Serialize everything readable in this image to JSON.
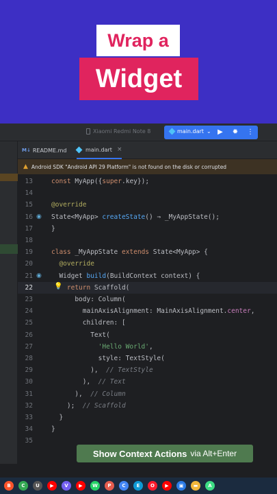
{
  "promo": {
    "line1": "Wrap a",
    "line2": "Widget"
  },
  "toolbar": {
    "device": "Xiaomi Redmi Note 8",
    "run_config": "main.dart",
    "run_config_arrow": "⌄",
    "play_icon": "▶",
    "debug_icon": "✹",
    "more_icon": "⋮"
  },
  "tabs": [
    {
      "icon": "M↓",
      "label": "README.md"
    },
    {
      "label": "main.dart",
      "close": "×"
    }
  ],
  "warning": {
    "icon": "▲",
    "text": "Android SDK \"Android API 29 Platform\" is not found on the disk or corrupted"
  },
  "code": {
    "lines": [
      {
        "n": "13",
        "parts": [
          [
            "kw",
            "const "
          ],
          [
            "cls",
            "MyApp("
          ],
          [
            "",
            "{"
          ],
          [
            "kw",
            "super"
          ],
          [
            "",
            ".key});"
          ]
        ]
      },
      {
        "n": "14",
        "parts": []
      },
      {
        "n": "15",
        "parts": [
          [
            "ann",
            "@override"
          ]
        ]
      },
      {
        "n": "16",
        "parts": [
          [
            "",
            "State<MyApp> "
          ],
          [
            "fn",
            "createState"
          ],
          [
            "",
            "() ⇒ _MyAppState();"
          ]
        ]
      },
      {
        "n": "17",
        "parts": [
          [
            "",
            "}"
          ]
        ]
      },
      {
        "n": "18",
        "parts": []
      },
      {
        "n": "19",
        "parts": [
          [
            "kw",
            "class "
          ],
          [
            "",
            "_MyAppState "
          ],
          [
            "kw",
            "extends "
          ],
          [
            "",
            "State<MyApp> {"
          ]
        ]
      },
      {
        "n": "20",
        "parts": [
          [
            "ann",
            "  @override"
          ]
        ]
      },
      {
        "n": "21",
        "parts": [
          [
            "",
            "  Widget "
          ],
          [
            "fn",
            "build"
          ],
          [
            "",
            "(BuildContext context) {"
          ]
        ]
      },
      {
        "n": "22",
        "parts": [
          [
            "kw",
            "    return "
          ],
          [
            "",
            "Scaffold("
          ]
        ]
      },
      {
        "n": "23",
        "parts": [
          [
            "",
            "      body: Column("
          ]
        ]
      },
      {
        "n": "24",
        "parts": [
          [
            "",
            "        mainAxisAlignment: MainAxisAlignment."
          ],
          [
            "fld",
            "center"
          ],
          [
            "",
            ","
          ]
        ]
      },
      {
        "n": "25",
        "parts": [
          [
            "",
            "        children: ["
          ]
        ]
      },
      {
        "n": "26",
        "parts": [
          [
            "",
            "          Text("
          ]
        ]
      },
      {
        "n": "27",
        "parts": [
          [
            "str",
            "            'Hello World'"
          ],
          [
            "",
            ","
          ]
        ]
      },
      {
        "n": "28",
        "parts": [
          [
            "",
            "            style: TextStyle("
          ]
        ]
      },
      {
        "n": "29",
        "parts": [
          [
            "",
            "          ), "
          ],
          [
            "cmt",
            " // TextStyle"
          ]
        ]
      },
      {
        "n": "30",
        "parts": [
          [
            "",
            "        ), "
          ],
          [
            "cmt",
            " // Text"
          ]
        ]
      },
      {
        "n": "31",
        "parts": [
          [
            "",
            "      ), "
          ],
          [
            "cmt",
            " // Column"
          ]
        ]
      },
      {
        "n": "32",
        "parts": [
          [
            "",
            "    ); "
          ],
          [
            "cmt",
            " // Scaffold"
          ]
        ]
      },
      {
        "n": "33",
        "parts": [
          [
            "",
            "  }"
          ]
        ]
      },
      {
        "n": "34",
        "parts": [
          [
            "",
            "}"
          ]
        ]
      },
      {
        "n": "35",
        "parts": []
      }
    ],
    "current_line": "22"
  },
  "context_action": {
    "bold": "Show Context Actions",
    "rest": "via Alt+Enter"
  },
  "taskbar": [
    {
      "name": "brave-icon",
      "color": "#fb542b",
      "glyph": "B"
    },
    {
      "name": "chrome-icon",
      "color": "#34a853",
      "glyph": "C"
    },
    {
      "name": "unity-icon",
      "color": "#555555",
      "glyph": "U"
    },
    {
      "name": "youtube-icon",
      "color": "#ff0000",
      "glyph": "▶"
    },
    {
      "name": "viber-icon",
      "color": "#7360f2",
      "glyph": "V"
    },
    {
      "name": "youtube-icon-2",
      "color": "#ff0000",
      "glyph": "▶"
    },
    {
      "name": "whatsapp-icon",
      "color": "#25d366",
      "glyph": "W"
    },
    {
      "name": "photos-icon",
      "color": "#e35c4e",
      "glyph": "P"
    },
    {
      "name": "chrome-icon-2",
      "color": "#4285f4",
      "glyph": "C"
    },
    {
      "name": "edge-icon",
      "color": "#0f9ad5",
      "glyph": "E"
    },
    {
      "name": "opera-icon",
      "color": "#ff1b2d",
      "glyph": "O"
    },
    {
      "name": "youtube-icon-3",
      "color": "#ff0000",
      "glyph": "▶"
    },
    {
      "name": "app-icon",
      "color": "#2c7be5",
      "glyph": "▣"
    },
    {
      "name": "folder-icon",
      "color": "#f2b73b",
      "glyph": "▬"
    },
    {
      "name": "androidstudio-icon",
      "color": "#3ddc84",
      "glyph": "A"
    }
  ]
}
